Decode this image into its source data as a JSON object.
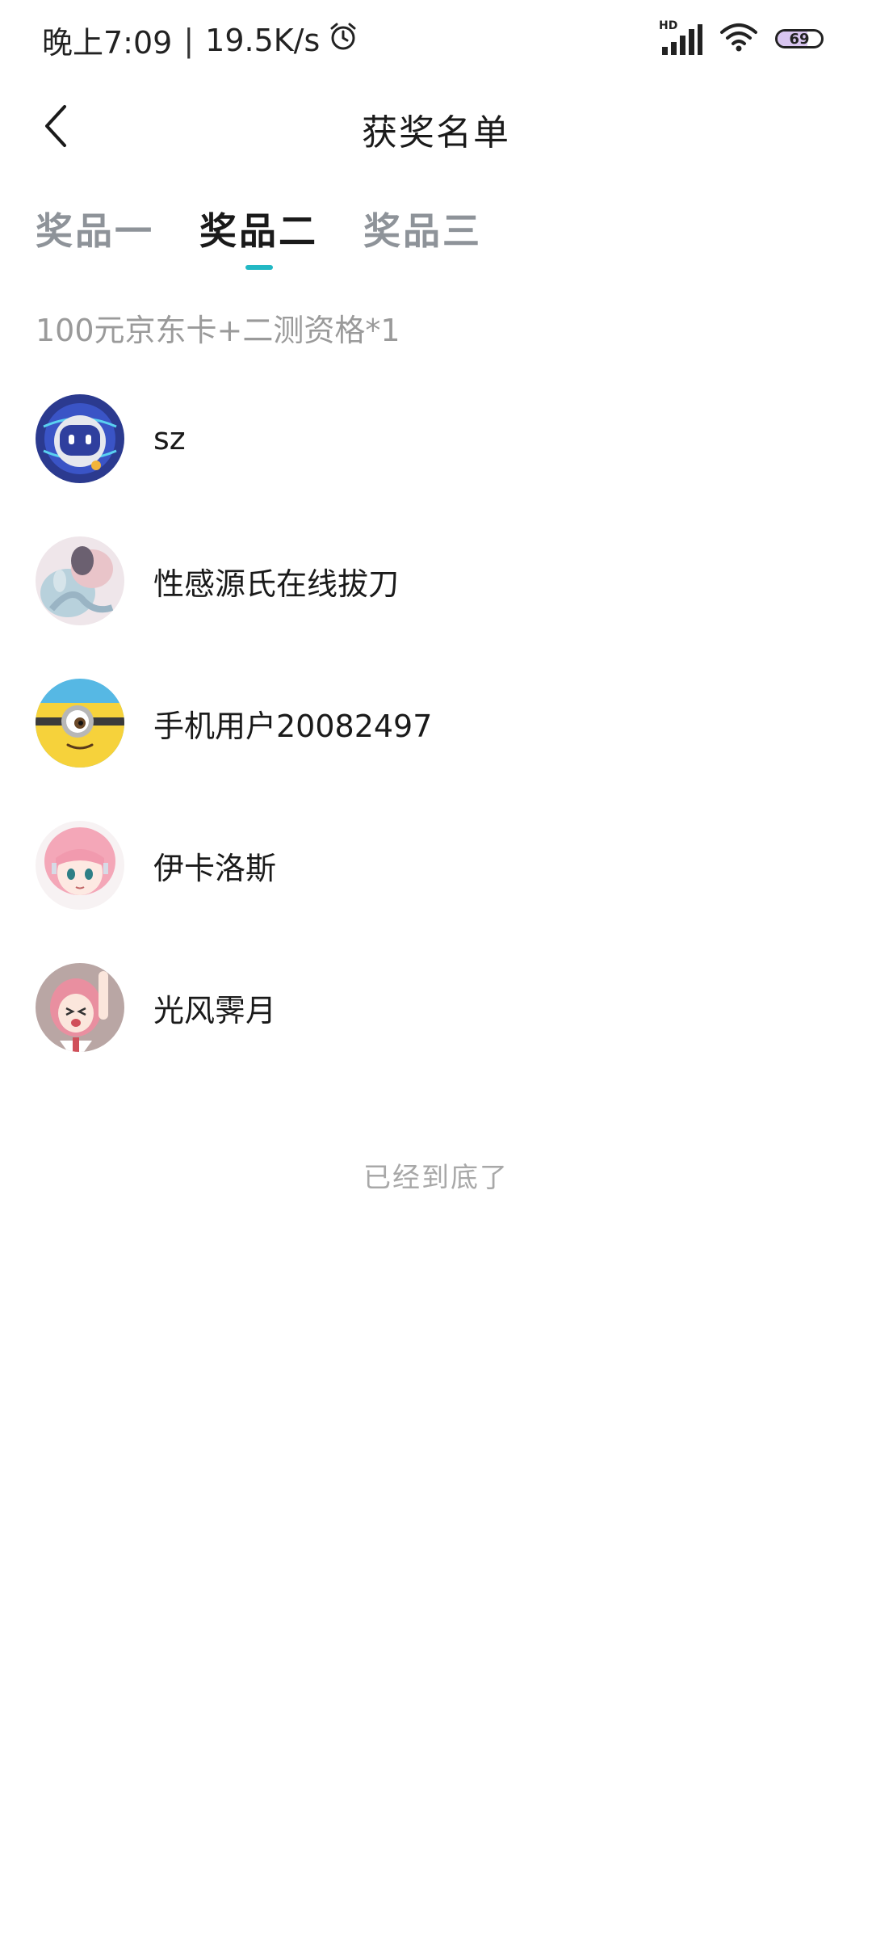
{
  "status_bar": {
    "time": "晚上7:09",
    "network_speed": "19.5K/s",
    "alarm_icon": "alarm-clock-icon",
    "signal_label": "HD",
    "battery_level": "69",
    "battery_fraction": 0.69
  },
  "header": {
    "title": "获奖名单",
    "back_icon": "chevron-left-icon"
  },
  "tabs": [
    {
      "label": "奖品一",
      "active": false
    },
    {
      "label": "奖品二",
      "active": true
    },
    {
      "label": "奖品三",
      "active": false
    }
  ],
  "prize_description": "100元京东卡+二测资格*1",
  "winners": [
    {
      "name": "sz",
      "avatar": "robot-avatar"
    },
    {
      "name": "性感源氏在线拔刀",
      "avatar": "photo-avatar"
    },
    {
      "name": "手机用户20082497",
      "avatar": "minion-avatar"
    },
    {
      "name": "伊卡洛斯",
      "avatar": "anime-girl-avatar"
    },
    {
      "name": "光风霁月",
      "avatar": "anime-girl-waving-avatar"
    }
  ],
  "end_message": "已经到底了",
  "colors": {
    "accent": "#22b8c4",
    "inactive_tab": "#8e9399",
    "muted_text": "#9a9a9a"
  }
}
